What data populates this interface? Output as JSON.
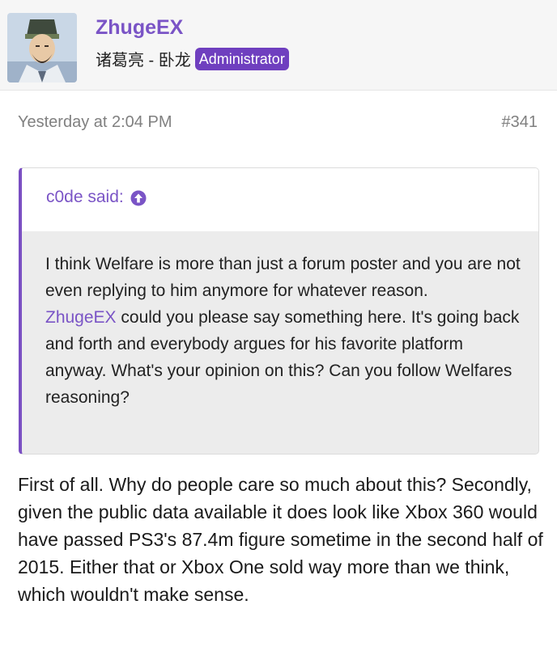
{
  "post": {
    "author": {
      "username": "ZhugeEX",
      "title": "诸葛亮 - 卧龙",
      "role": "Administrator"
    },
    "timestamp": "Yesterday at 2:04 PM",
    "number": "#341",
    "quote": {
      "author_label": "c0de said:",
      "icon": "arrow-up-circle-icon",
      "lines_before_mention": "I think Welfare is more than just a forum poster and you are not even replying to him anymore for whatever reason.",
      "mention": "ZhugeEX",
      "lines_after_mention": " could you please say something here. It's going back and forth and everybody argues for his favorite platform anyway. What's your opinion on this? Can you follow Welfares reasoning?"
    },
    "body": "First of all. Why do people care so much about this? Secondly, given the public data available it does look like Xbox 360 would have passed PS3's 87.4m figure sometime in the second half of 2015. Either that or Xbox One sold way more than we think, which wouldn't make sense."
  },
  "colors": {
    "accent": "#7a54c6",
    "badge": "#6f3fbf"
  }
}
